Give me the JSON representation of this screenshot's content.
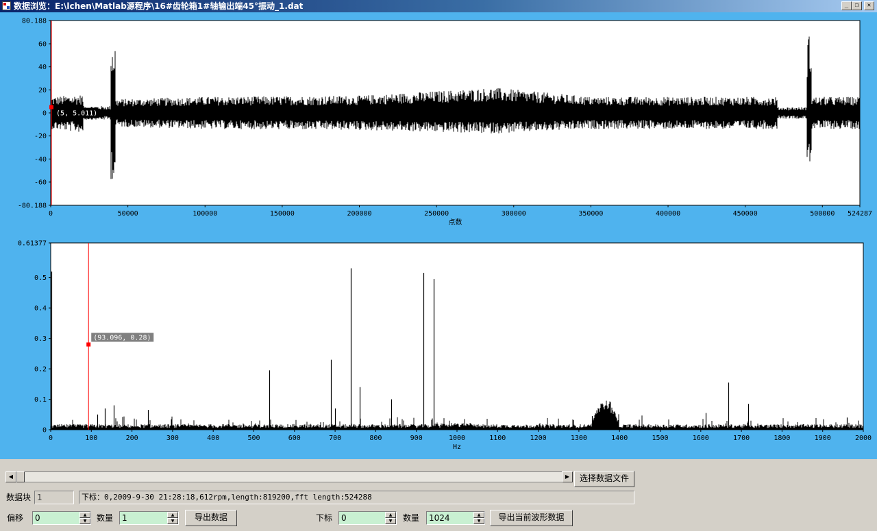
{
  "window": {
    "title": "数据浏览：E:\\lchen\\Matlab源程序\\16#齿轮箱1#轴输出端45°振动_1.dat",
    "minimize": "_",
    "restore": "❐",
    "close": "✕",
    "icon": "app-window-icon"
  },
  "chart_data": [
    {
      "type": "line",
      "xlabel": "点数",
      "ylabel": "",
      "xlim": [
        0,
        524287
      ],
      "ylim": [
        -80.188,
        80.188
      ],
      "x_ticks": [
        "0",
        "50000",
        "100000",
        "150000",
        "200000",
        "250000",
        "300000",
        "350000",
        "400000",
        "450000",
        "500000",
        "524287"
      ],
      "y_ticks": [
        "80.188",
        "60",
        "40",
        "20",
        "0",
        "-20",
        "-40",
        "-60",
        "-80.188"
      ],
      "cursor": {
        "x": 5,
        "y": 5.011,
        "label": "(5, 5.011)",
        "color": "#ff0000"
      },
      "envelope": [
        {
          "x": 0,
          "upper": 14,
          "lower": -14
        },
        {
          "x": 20000,
          "upper": 16,
          "lower": -17
        },
        {
          "x": 21000,
          "upper": 6,
          "lower": -6
        },
        {
          "x": 39000,
          "upper": 6,
          "lower": -6
        },
        {
          "x": 40000,
          "upper": 63,
          "lower": -58
        },
        {
          "x": 42000,
          "upper": 12,
          "lower": -12
        },
        {
          "x": 100000,
          "upper": 14,
          "lower": -14
        },
        {
          "x": 200000,
          "upper": 15,
          "lower": -15
        },
        {
          "x": 287000,
          "upper": 22,
          "lower": -18
        },
        {
          "x": 350000,
          "upper": 14,
          "lower": -14
        },
        {
          "x": 470000,
          "upper": 14,
          "lower": -14
        },
        {
          "x": 471000,
          "upper": 5,
          "lower": -5
        },
        {
          "x": 490000,
          "upper": 5,
          "lower": -5
        },
        {
          "x": 491000,
          "upper": 68,
          "lower": -43
        },
        {
          "x": 493000,
          "upper": 14,
          "lower": -14
        },
        {
          "x": 524287,
          "upper": 14,
          "lower": -14
        }
      ]
    },
    {
      "type": "line",
      "xlabel": "Hz",
      "ylabel": "",
      "xlim": [
        0,
        2000
      ],
      "ylim": [
        0,
        0.61377
      ],
      "x_ticks": [
        "0",
        "100",
        "200",
        "300",
        "400",
        "500",
        "600",
        "700",
        "800",
        "900",
        "1000",
        "1100",
        "1200",
        "1300",
        "1400",
        "1500",
        "1600",
        "1700",
        "1800",
        "1900",
        "2000"
      ],
      "y_ticks": [
        "0.61377",
        "0.5",
        "0.4",
        "0.3",
        "0.2",
        "0.1",
        "0"
      ],
      "cursor": {
        "x": 93.096,
        "y": 0.28,
        "label": "(93.096, 0.28)",
        "color": "#ff0000"
      },
      "peaks": [
        {
          "x": 2,
          "y": 0.52
        },
        {
          "x": 115,
          "y": 0.05
        },
        {
          "x": 133,
          "y": 0.07
        },
        {
          "x": 155,
          "y": 0.08
        },
        {
          "x": 240,
          "y": 0.065
        },
        {
          "x": 538,
          "y": 0.195
        },
        {
          "x": 690,
          "y": 0.23
        },
        {
          "x": 700,
          "y": 0.07
        },
        {
          "x": 738,
          "y": 0.53
        },
        {
          "x": 760,
          "y": 0.14
        },
        {
          "x": 838,
          "y": 0.1
        },
        {
          "x": 918,
          "y": 0.515
        },
        {
          "x": 942,
          "y": 0.495
        },
        {
          "x": 1333,
          "y": 0.045
        },
        {
          "x": 1612,
          "y": 0.055
        },
        {
          "x": 1667,
          "y": 0.155
        },
        {
          "x": 1717,
          "y": 0.085
        },
        {
          "x": 1960,
          "y": 0.04
        }
      ],
      "broadband_hump": {
        "from": 1330,
        "to": 1400,
        "peak": 0.09
      }
    }
  ],
  "controls": {
    "scroll_left": "◀",
    "scroll_right": "▶",
    "select_file_button": "选择数据文件",
    "block_label": "数据块",
    "block_value": "1",
    "info_text": "下标：0,2009-9-30 21:28:18,612rpm,length:819200,fft length:524288",
    "offset_label": "偏移",
    "offset_value": "0",
    "count_label": "数量",
    "count_value": "1",
    "export_button": "导出数据",
    "index_label": "下标",
    "index_value": "0",
    "count2_label": "数量",
    "count2_value": "1024",
    "export_wave_button": "导出当前波形数据",
    "spin_up": "▲",
    "spin_down": "▼"
  }
}
